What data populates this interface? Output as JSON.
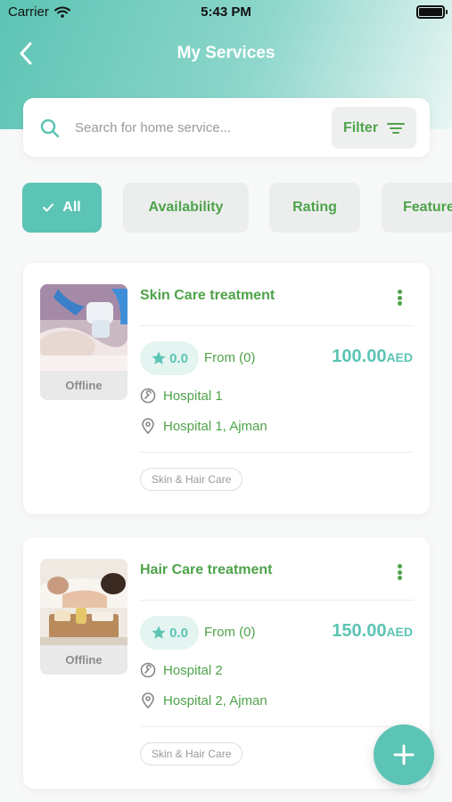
{
  "status_bar": {
    "carrier": "Carrier",
    "time": "5:43 PM"
  },
  "header": {
    "title": "My Services"
  },
  "search": {
    "placeholder": "Search for home service...",
    "filter_label": "Filter"
  },
  "chips": [
    {
      "label": "All",
      "active": true
    },
    {
      "label": "Availability",
      "active": false
    },
    {
      "label": "Rating",
      "active": false
    },
    {
      "label": "Featured",
      "active": false
    }
  ],
  "services": [
    {
      "title": "Skin Care treatment",
      "status": "Offline",
      "rating": "0.0",
      "from": "From (0)",
      "price": "100.00",
      "currency": "AED",
      "provider": "Hospital 1",
      "location": "Hospital 1, Ajman",
      "tag": "Skin & Hair Care"
    },
    {
      "title": "Hair Care treatment",
      "status": "Offline",
      "rating": "0.0",
      "from": "From (0)",
      "price": "150.00",
      "currency": "AED",
      "provider": "Hospital 2",
      "location": "Hospital 2, Ajman",
      "tag": "Skin & Hair Care"
    }
  ],
  "icons": {
    "back": "chevron-left-icon",
    "search": "search-icon",
    "filter": "filter-lines-icon",
    "check": "check-icon",
    "star": "star-icon",
    "provider": "wrench-circle-icon",
    "location": "map-pin-icon",
    "more": "more-vertical-icon",
    "add": "plus-icon"
  },
  "colors": {
    "primary": "#5cc4b4",
    "accent_green": "#4fa34a",
    "background": "#f7f8f8"
  }
}
